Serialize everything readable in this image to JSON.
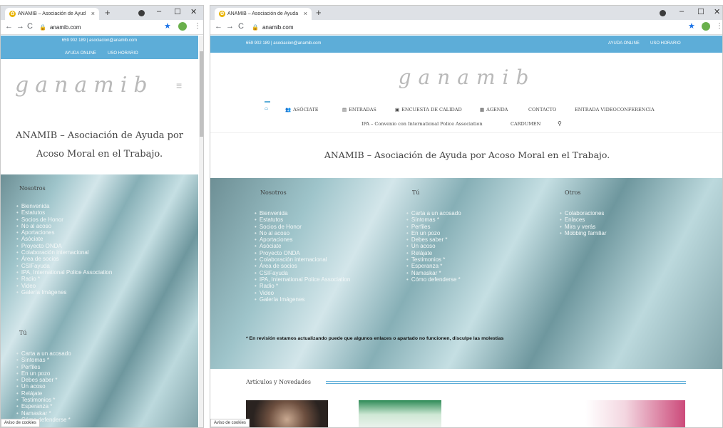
{
  "browser": {
    "tab_title": "ANAMIB – Asociación de Ayuda",
    "tab_title_short": "ANAMIB – Asociación de Ayud",
    "url": "anamib.com",
    "new_tab": "+",
    "minimize": "–",
    "maximize": "☐",
    "close": "✕"
  },
  "header": {
    "contact": "659 902 189 | asociacion@anamib.com",
    "online_help": "AYUDA ONLINE",
    "timezone": "USO HORARIO",
    "logo": "ganamib"
  },
  "menu": {
    "items": [
      {
        "icon": "👥",
        "label": "ASÓCIATE"
      },
      {
        "icon": "▤",
        "label": "ENTRADAS"
      },
      {
        "icon": "▣",
        "label": "ENCUESTA DE CALIDAD"
      },
      {
        "icon": "▦",
        "label": "AGENDA"
      },
      {
        "icon": "",
        "label": "CONTACTO"
      },
      {
        "icon": "",
        "label": "ENTRADA VIDEOCONFERENCIA"
      }
    ],
    "items2": [
      "IPA – Convenio con International Police Association",
      "CARDUMEN"
    ]
  },
  "site_title": "ANAMIB – Asociación de Ayuda por Acoso Moral en el Trabajo.",
  "site_title_l1": "ANAMIB – Asociación de Ayuda por",
  "site_title_l2": "Acoso Moral en el Trabajo.",
  "sections": {
    "nosotros": {
      "title": "Nosotros",
      "links": [
        "Bienvenida",
        "Estatutos",
        "Socios de Honor",
        "No al acoso",
        "Aportaciones",
        "Asóciate",
        "Proyecto ONDA",
        "Colaboración internacional",
        "Área de socios",
        "CSIFayuda",
        "IPA, International Police Association",
        "Radio *",
        "Video",
        "Galería Imágenes"
      ]
    },
    "tu": {
      "title": "Tú",
      "links": [
        "Carta a un acosado",
        "Síntomas *",
        "Perfiles",
        "En un pozo",
        "Debes saber *",
        "Un acoso",
        "Relájate",
        "Testimonios *",
        "Esperanza *",
        "Namaskar *",
        "Cómo defenderse *"
      ]
    },
    "otros": {
      "title": "Otros",
      "links": [
        "Colaboraciones",
        "Enlaces",
        "Mira y verás",
        "Mobbing familiar"
      ]
    }
  },
  "notice": "* En revisión estamos actualizando puede que algunos enlaces o apartado no funcionen, disculpe las molestias",
  "articles_title": "Artículos y Novedades",
  "cookies": "Aviso de cookies",
  "colors": {
    "accent": "#5dadd8",
    "footer": "#5c7880"
  }
}
